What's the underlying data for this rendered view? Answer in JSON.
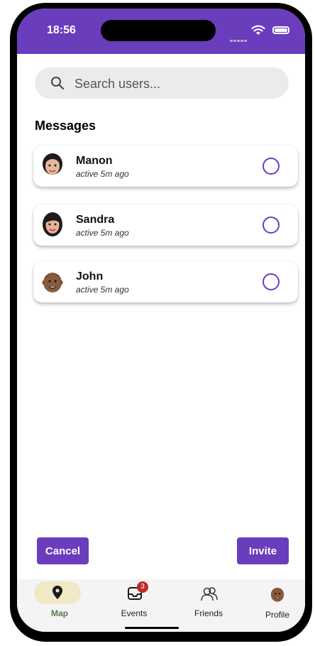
{
  "status_bar": {
    "time": "18:56"
  },
  "search": {
    "placeholder": "Search users..."
  },
  "messages": {
    "title": "Messages",
    "items": [
      {
        "name": "Manon",
        "status": "active 5m ago"
      },
      {
        "name": "Sandra",
        "status": "active 5m ago"
      },
      {
        "name": "John",
        "status": "active 5m ago"
      }
    ]
  },
  "actions": {
    "cancel_label": "Cancel",
    "invite_label": "Invite"
  },
  "tabbar": {
    "items": [
      {
        "label": "Map",
        "icon": "map-pin-icon",
        "active": true
      },
      {
        "label": "Events",
        "icon": "inbox-icon",
        "badge": "3"
      },
      {
        "label": "Friends",
        "icon": "friends-icon"
      },
      {
        "label": "Profile",
        "icon": "avatar"
      }
    ]
  },
  "colors": {
    "accent": "#6a3dbd",
    "tab_active_bg": "#efe9c6",
    "badge": "#c0282a"
  }
}
